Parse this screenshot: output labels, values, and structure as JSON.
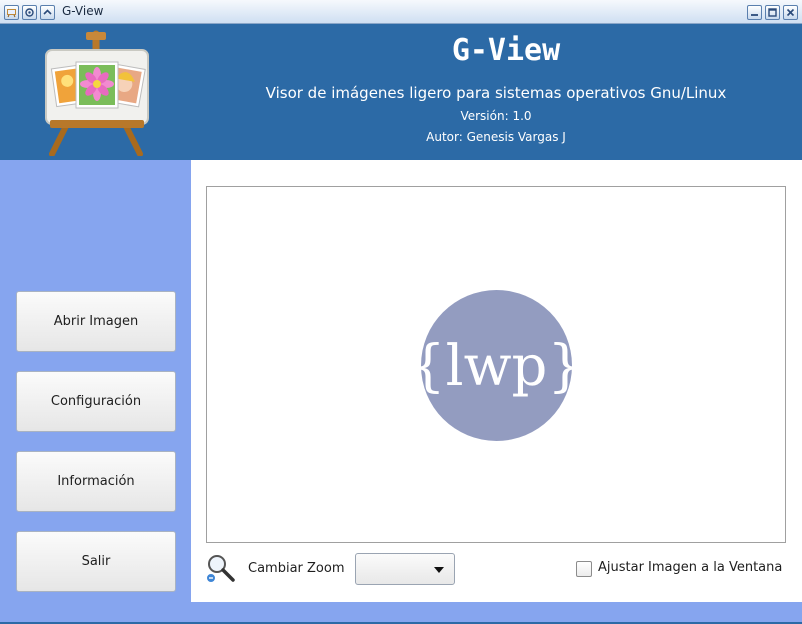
{
  "window": {
    "title": "G-View"
  },
  "header": {
    "app_title": "G-View",
    "subtitle": "Visor de imágenes ligero para sistemas operativos Gnu/Linux",
    "version": "Versión: 1.0",
    "author": "Autor: Genesis Vargas J"
  },
  "sidebar": {
    "buttons": [
      {
        "label": "Abrir Imagen"
      },
      {
        "label": "Configuración"
      },
      {
        "label": "Información"
      },
      {
        "label": "Salir"
      }
    ]
  },
  "viewer": {
    "logo_text": "{lwp}"
  },
  "controls": {
    "zoom_label": "Cambiar Zoom",
    "zoom_value": "",
    "fit_label": "Ajustar Imagen a la Ventana",
    "fit_checked": false
  },
  "colors": {
    "header_bg": "#2c6aa6",
    "sidebar_bg": "#86a5ef",
    "logo_circle": "#939cc0"
  },
  "icons": {
    "app": "easel-picture-icon",
    "zoom": "magnifier-icon"
  }
}
